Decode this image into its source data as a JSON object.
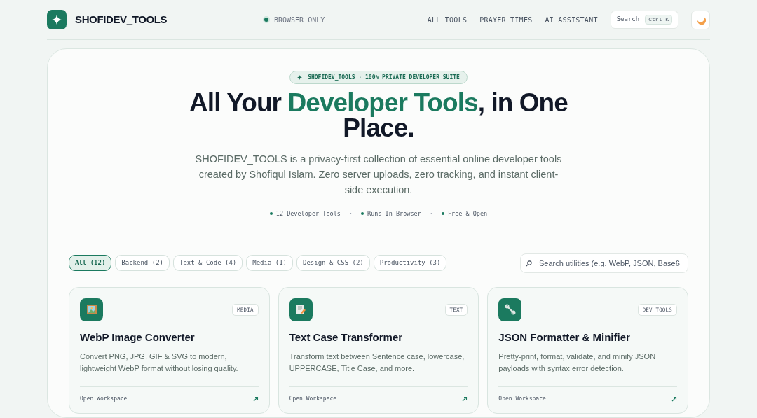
{
  "header": {
    "brand": "SHOFIDEV_TOOLS",
    "status": "BROWSER ONLY",
    "nav": [
      {
        "label": "ALL TOOLS"
      },
      {
        "label": "PRAYER TIMES"
      },
      {
        "label": "AI ASSISTANT"
      }
    ],
    "search": {
      "label": "Search",
      "shortcut": "Ctrl K"
    }
  },
  "hero": {
    "badge": "SHOFIDEV_TOOLS · 100% PRIVATE DEVELOPER SUITE",
    "headline": [
      {
        "text": "All Your ",
        "highlight": false
      },
      {
        "text": "Developer Tools",
        "highlight": true
      },
      {
        "text": ", in One Place.",
        "highlight": false
      }
    ],
    "description": "SHOFIDEV_TOOLS is a privacy-first collection of essential online developer tools created by Shofiqul Islam. Zero server uploads, zero tracking, and instant client-side execution.",
    "stats": [
      "12 Developer Tools",
      "Runs In-Browser",
      "Free & Open"
    ],
    "separator": "·"
  },
  "filters": [
    {
      "label": "All (12)",
      "selected": true
    },
    {
      "label": "Backend (2)",
      "selected": false
    },
    {
      "label": "Text & Code (4)",
      "selected": false
    },
    {
      "label": "Media (1)",
      "selected": false
    },
    {
      "label": "Design & CSS (2)",
      "selected": false
    },
    {
      "label": "Productivity (3)",
      "selected": false
    }
  ],
  "search": {
    "placeholder": "Search utilities (e.g. WebP, JSON, Base6"
  },
  "tools": [
    {
      "tag": "MEDIA",
      "title": "WebP Image Converter",
      "description": "Convert PNG, JPG, GIF & SVG to modern, lightweight WebP format without losing quality.",
      "action": "Open Workspace"
    },
    {
      "tag": "TEXT",
      "title": "Text Case Transformer",
      "description": "Transform text between Sentence case, lowercase, UPPERCASE, Title Case, and more.",
      "action": "Open Workspace"
    },
    {
      "tag": "DEV TOOLS",
      "title": "JSON Formatter & Minifier",
      "description": "Pretty-print, format, validate, and minify JSON payloads with syntax error detection.",
      "action": "Open Workspace"
    }
  ]
}
